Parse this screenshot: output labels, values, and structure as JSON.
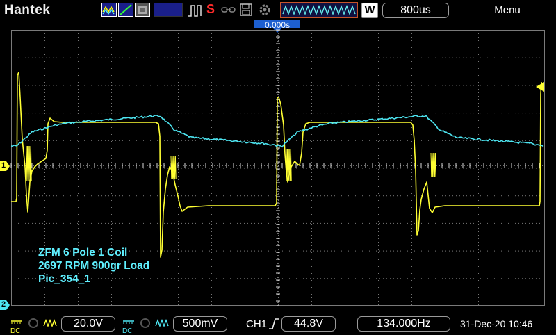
{
  "brand": "Hantek",
  "trigger_position": "0.000s",
  "timebase": {
    "mode": "W",
    "value": "800us"
  },
  "menu": "Menu",
  "overlay": {
    "line1": "ZFM 6 Pole 1 Coil",
    "line2": "2697 RPM  900gr Load",
    "line3": "Pic_354_1"
  },
  "markers": {
    "ch1": "1",
    "ch2": "2"
  },
  "ch1": {
    "coupling": "DC",
    "scale": "20.0V",
    "color": "#ffff33"
  },
  "ch2": {
    "coupling": "DC",
    "scale": "500mV",
    "color": "#4ee6f2"
  },
  "trigger": {
    "source": "CH1",
    "level": "44.8V"
  },
  "frequency": "134.000Hz",
  "datetime": "31-Dec-20 10:46",
  "icons": [
    "waveform-mode-icon",
    "ramp-icon",
    "persistence-icon",
    "run-icon",
    "stop-icon",
    "save-icon",
    "settings-icon",
    "memory-icon"
  ]
}
